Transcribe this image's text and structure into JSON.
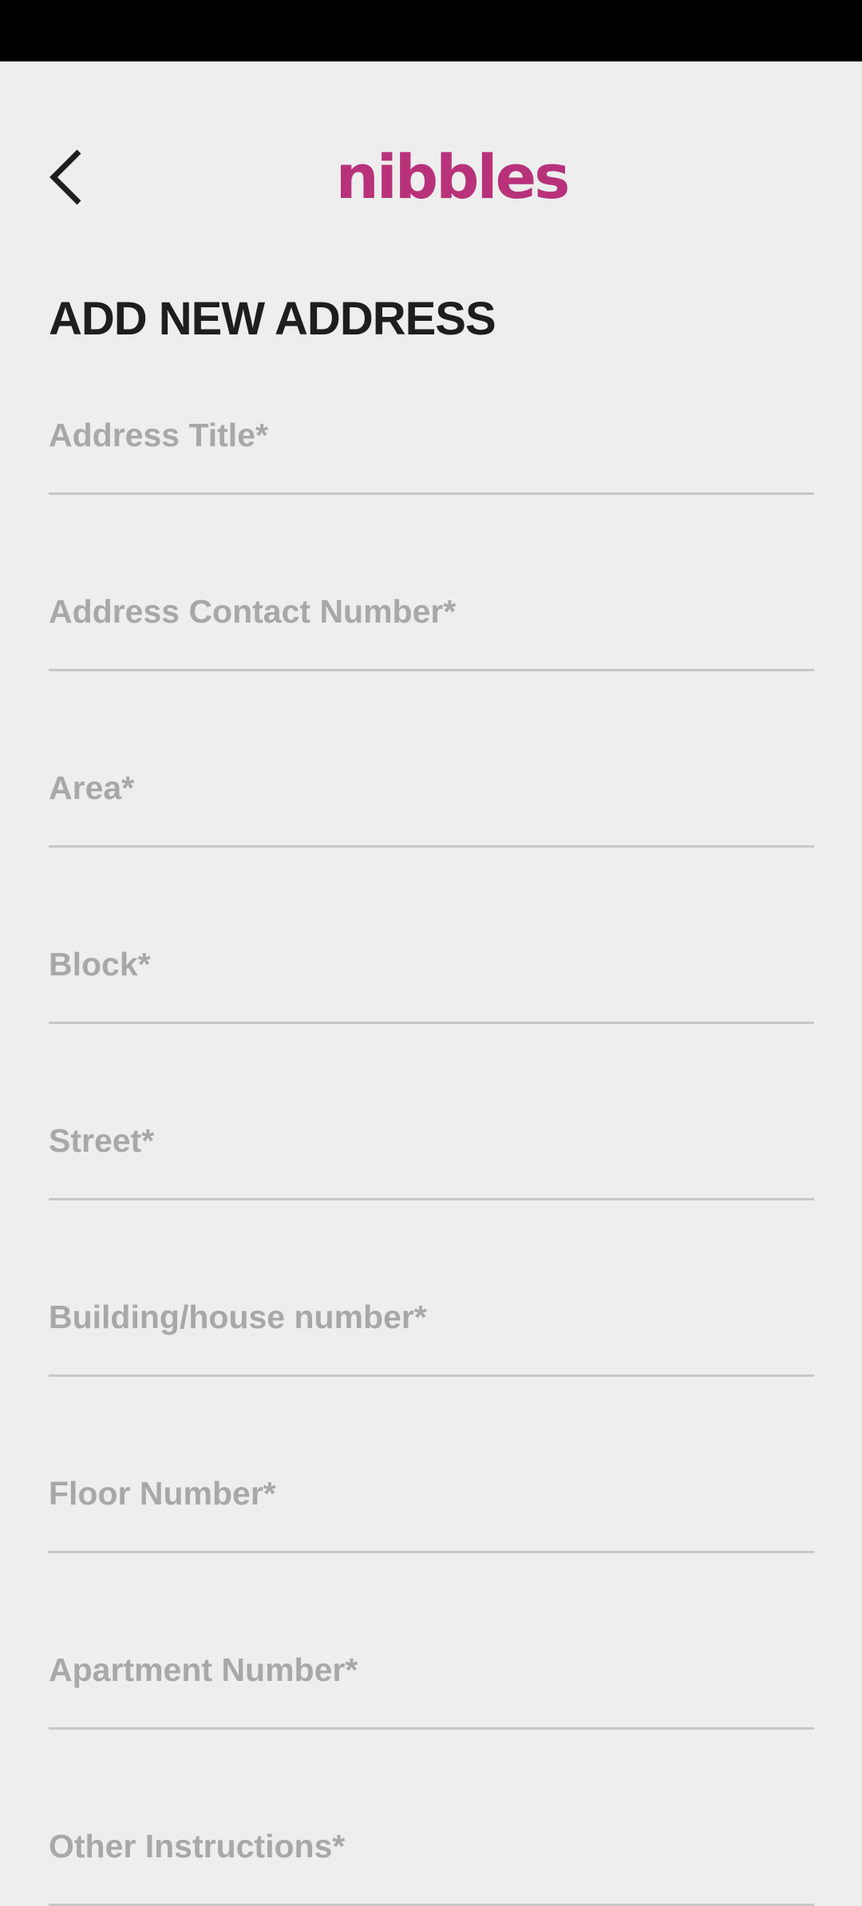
{
  "colors": {
    "brand": "#b8327a",
    "background": "#eeeeee",
    "status_bar": "#000000",
    "title": "#1e1e1e",
    "placeholder": "#a8a8a8",
    "divider": "#c7c7c7"
  },
  "header": {
    "back_icon": "chevron-left-icon",
    "logo_text": "nibbles"
  },
  "page": {
    "title": "ADD NEW ADDRESS"
  },
  "form": {
    "fields": [
      {
        "key": "address_title",
        "placeholder": "Address Title*",
        "value": ""
      },
      {
        "key": "contact_number",
        "placeholder": "Address Contact Number*",
        "value": ""
      },
      {
        "key": "area",
        "placeholder": "Area*",
        "value": ""
      },
      {
        "key": "block",
        "placeholder": "Block*",
        "value": ""
      },
      {
        "key": "street",
        "placeholder": "Street*",
        "value": ""
      },
      {
        "key": "building",
        "placeholder": "Building/house number*",
        "value": ""
      },
      {
        "key": "floor",
        "placeholder": "Floor Number*",
        "value": ""
      },
      {
        "key": "apartment",
        "placeholder": "Apartment Number*",
        "value": ""
      },
      {
        "key": "instructions",
        "placeholder": "Other Instructions*",
        "value": ""
      }
    ]
  }
}
